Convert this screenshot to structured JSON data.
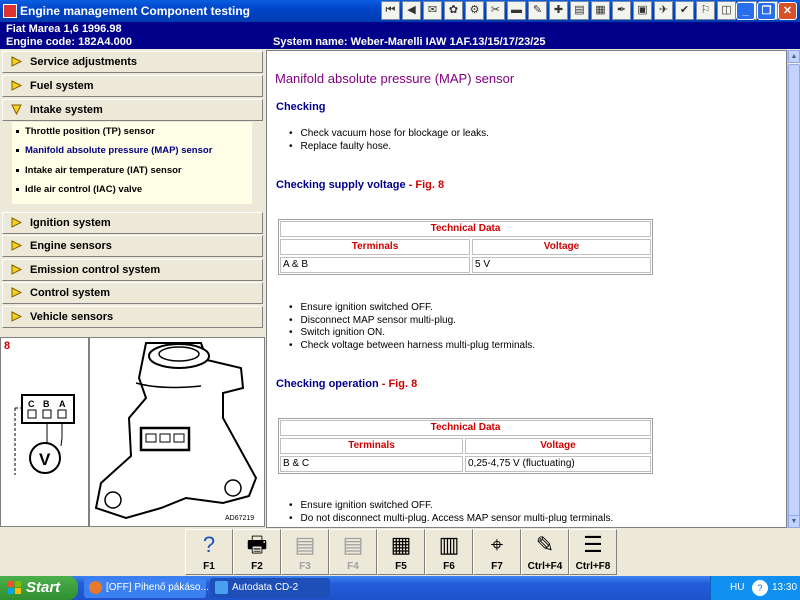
{
  "window": {
    "title": "Engine management Component testing",
    "toolbar_icons": [
      "first-icon",
      "prev-icon",
      "tool-icon",
      "tool-icon",
      "tool-icon",
      "tool-icon",
      "tool-icon",
      "tool-icon",
      "tool-icon",
      "tool-icon",
      "tool-icon",
      "tool-icon",
      "tool-icon",
      "tool-icon",
      "tool-icon",
      "tool-icon",
      "tool-icon",
      "tool-icon",
      "exit-icon"
    ],
    "minimize": "_",
    "restore": "❐",
    "close": "✕"
  },
  "vehicle": {
    "line1": "Fiat   Marea 1,6   1996.98",
    "line2": "Engine code: 182A4.000",
    "system": "System name: Weber-Marelli IAW 1AF.13/15/17/23/25"
  },
  "sidebar": {
    "items": [
      {
        "label": "Service adjustments"
      },
      {
        "label": "Fuel system"
      },
      {
        "label": "Intake system"
      },
      {
        "label": "Ignition system"
      },
      {
        "label": "Engine sensors"
      },
      {
        "label": "Emission control system"
      },
      {
        "label": "Control system"
      },
      {
        "label": "Vehicle sensors"
      }
    ],
    "subitems": [
      {
        "label": "Throttle position (TP) sensor"
      },
      {
        "label": "Manifold absolute pressure (MAP) sensor"
      },
      {
        "label": "Intake air temperature (IAT) sensor"
      },
      {
        "label": "Idle air control (IAC) valve"
      }
    ]
  },
  "figure": {
    "number": "8",
    "pins": [
      "C",
      "B",
      "A"
    ],
    "meter": "V",
    "ref": "AD67219"
  },
  "content": {
    "title": "Manifold absolute pressure (MAP) sensor",
    "checking": {
      "heading": "Checking",
      "bullets": [
        "Check vacuum hose for blockage or leaks.",
        "Replace faulty hose."
      ]
    },
    "supply": {
      "heading": "Checking supply voltage",
      "fig": " - Fig. 8",
      "table_title": "Technical Data",
      "col1": "Terminals",
      "col2": "Voltage",
      "row_terminals": "A & B",
      "row_voltage": "5 V",
      "bullets": [
        "Ensure ignition switched OFF.",
        "Disconnect MAP sensor multi-plug.",
        "Switch ignition ON.",
        "Check voltage between harness multi-plug terminals."
      ]
    },
    "operation": {
      "heading": "Checking operation",
      "fig": " - Fig. 8",
      "table_title": "Technical Data",
      "col1": "Terminals",
      "col2": "Voltage",
      "row_terminals": "B & C",
      "row_voltage": "0,25-4,75 V (fluctuating)",
      "bullets": [
        "Ensure ignition switched OFF.",
        "Do not disconnect multi-plug. Access MAP sensor multi-plug terminals."
      ]
    }
  },
  "fbar": [
    {
      "label": "F1",
      "icon": "help-icon",
      "glyph": "?",
      "enabled": true
    },
    {
      "label": "F2",
      "icon": "print-icon",
      "glyph": "🖶",
      "enabled": true
    },
    {
      "label": "F3",
      "icon": "tool-disabled-icon",
      "glyph": "▤",
      "enabled": false
    },
    {
      "label": "F4",
      "icon": "tool-disabled-icon",
      "glyph": "▤",
      "enabled": false
    },
    {
      "label": "F5",
      "icon": "document-icon",
      "glyph": "▦",
      "enabled": true
    },
    {
      "label": "F6",
      "icon": "diagram-icon",
      "glyph": "▥",
      "enabled": true
    },
    {
      "label": "F7",
      "icon": "probe-icon",
      "glyph": "⌖",
      "enabled": true
    },
    {
      "label": "Ctrl+F4",
      "icon": "notes-icon",
      "glyph": "✎",
      "enabled": true
    },
    {
      "label": "Ctrl+F8",
      "icon": "list-icon",
      "glyph": "☰",
      "enabled": true
    }
  ],
  "taskbar": {
    "start": "Start",
    "tasks": [
      {
        "label": "[OFF] Pihenő pákáso..."
      },
      {
        "label": "Autodata CD-2"
      }
    ],
    "lang": "HU",
    "tray_icon": "?",
    "clock": "13:30"
  },
  "colors": {
    "title_bar": "#0046c8",
    "info_bar": "#00008a",
    "heading_blue": "#00008a",
    "title_purple": "#800080",
    "figure_red": "#d00000",
    "submenu_bg": "#ffffe8"
  }
}
